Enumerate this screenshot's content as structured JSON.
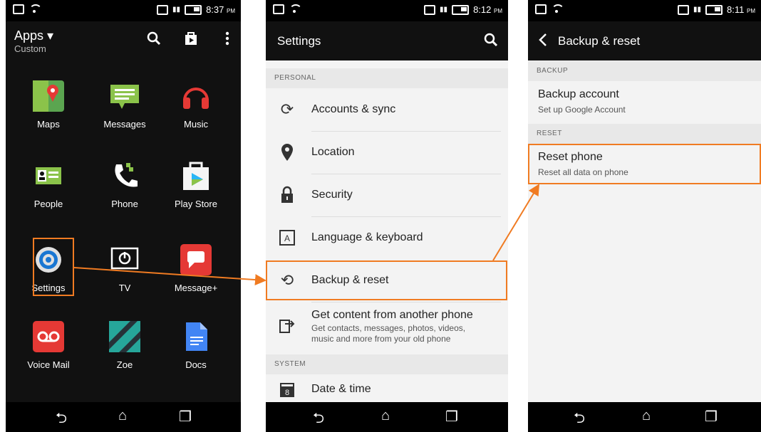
{
  "phone1": {
    "status": {
      "time": "8:37",
      "ampm": "PM"
    },
    "header": {
      "title": "Apps ▾",
      "subtitle": "Custom"
    },
    "apps": [
      {
        "label": "Maps"
      },
      {
        "label": "Messages"
      },
      {
        "label": "Music"
      },
      {
        "label": "People"
      },
      {
        "label": "Phone"
      },
      {
        "label": "Play Store"
      },
      {
        "label": "Settings"
      },
      {
        "label": "TV"
      },
      {
        "label": "Message+"
      },
      {
        "label": "Voice Mail"
      },
      {
        "label": "Zoe"
      },
      {
        "label": "Docs"
      }
    ]
  },
  "phone2": {
    "status": {
      "time": "8:12",
      "ampm": "PM"
    },
    "header": {
      "title": "Settings"
    },
    "sections": {
      "personal": "PERSONAL",
      "system": "SYSTEM"
    },
    "items": {
      "accounts": "Accounts & sync",
      "location": "Location",
      "security": "Security",
      "language": "Language & keyboard",
      "backup": "Backup & reset",
      "getcontent": "Get content from another phone",
      "getcontent_sub": "Get contacts, messages, photos, videos, music and more from your old phone",
      "datetime": "Date & time"
    }
  },
  "phone3": {
    "status": {
      "time": "8:11",
      "ampm": "PM"
    },
    "header": {
      "title": "Backup & reset"
    },
    "sections": {
      "backup": "BACKUP",
      "reset": "RESET"
    },
    "items": {
      "backup_title": "Backup account",
      "backup_sub": "Set up Google Account",
      "reset_title": "Reset phone",
      "reset_sub": "Reset all data on phone"
    }
  },
  "colors": {
    "highlight": "#f07b22",
    "dark": "#111111",
    "light": "#f3f3f3"
  }
}
